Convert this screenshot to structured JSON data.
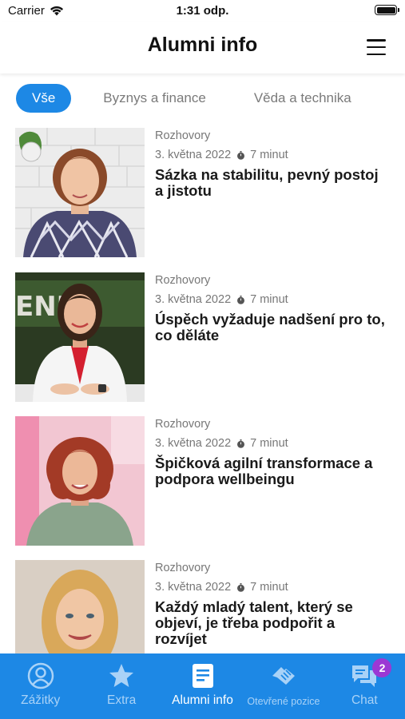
{
  "status_bar": {
    "carrier": "Carrier",
    "time": "1:31 odp."
  },
  "header": {
    "title": "Alumni info"
  },
  "tabs": [
    {
      "label": "Vše",
      "active": true
    },
    {
      "label": "Byznys a finance",
      "active": false
    },
    {
      "label": "Věda a technika",
      "active": false
    }
  ],
  "articles": [
    {
      "category": "Rozhovory",
      "date": "3. května 2022",
      "read_time": "7 minut",
      "title": "Sázka na stabilitu, pevný postoj a jistotu"
    },
    {
      "category": "Rozhovory",
      "date": "3. května 2022",
      "read_time": "7 minut",
      "title": "Úspěch vyžaduje nadšení pro to, co děláte"
    },
    {
      "category": "Rozhovory",
      "date": "3. května 2022",
      "read_time": "7 minut",
      "title": "Špičková agilní transformace a podpora wellbeingu"
    },
    {
      "category": "Rozhovory",
      "date": "3. května 2022",
      "read_time": "7 minut",
      "title": "Každý mladý talent, který se objeví, je třeba podpořit a rozvíjet"
    }
  ],
  "tabbar": {
    "items": [
      {
        "label": "Zážitky",
        "icon": "user-circle-icon",
        "active": false
      },
      {
        "label": "Extra",
        "icon": "star-icon",
        "active": false
      },
      {
        "label": "Alumni info",
        "icon": "document-icon",
        "active": true
      },
      {
        "label": "Otevřené pozice",
        "icon": "handshake-icon",
        "active": false
      },
      {
        "label": "Chat",
        "icon": "chat-bubbles-icon",
        "active": false,
        "badge": "2"
      }
    ]
  },
  "colors": {
    "accent": "#1d88e5",
    "badge": "#9b38d4",
    "inactive_tab_label": "#a9d2f7"
  }
}
